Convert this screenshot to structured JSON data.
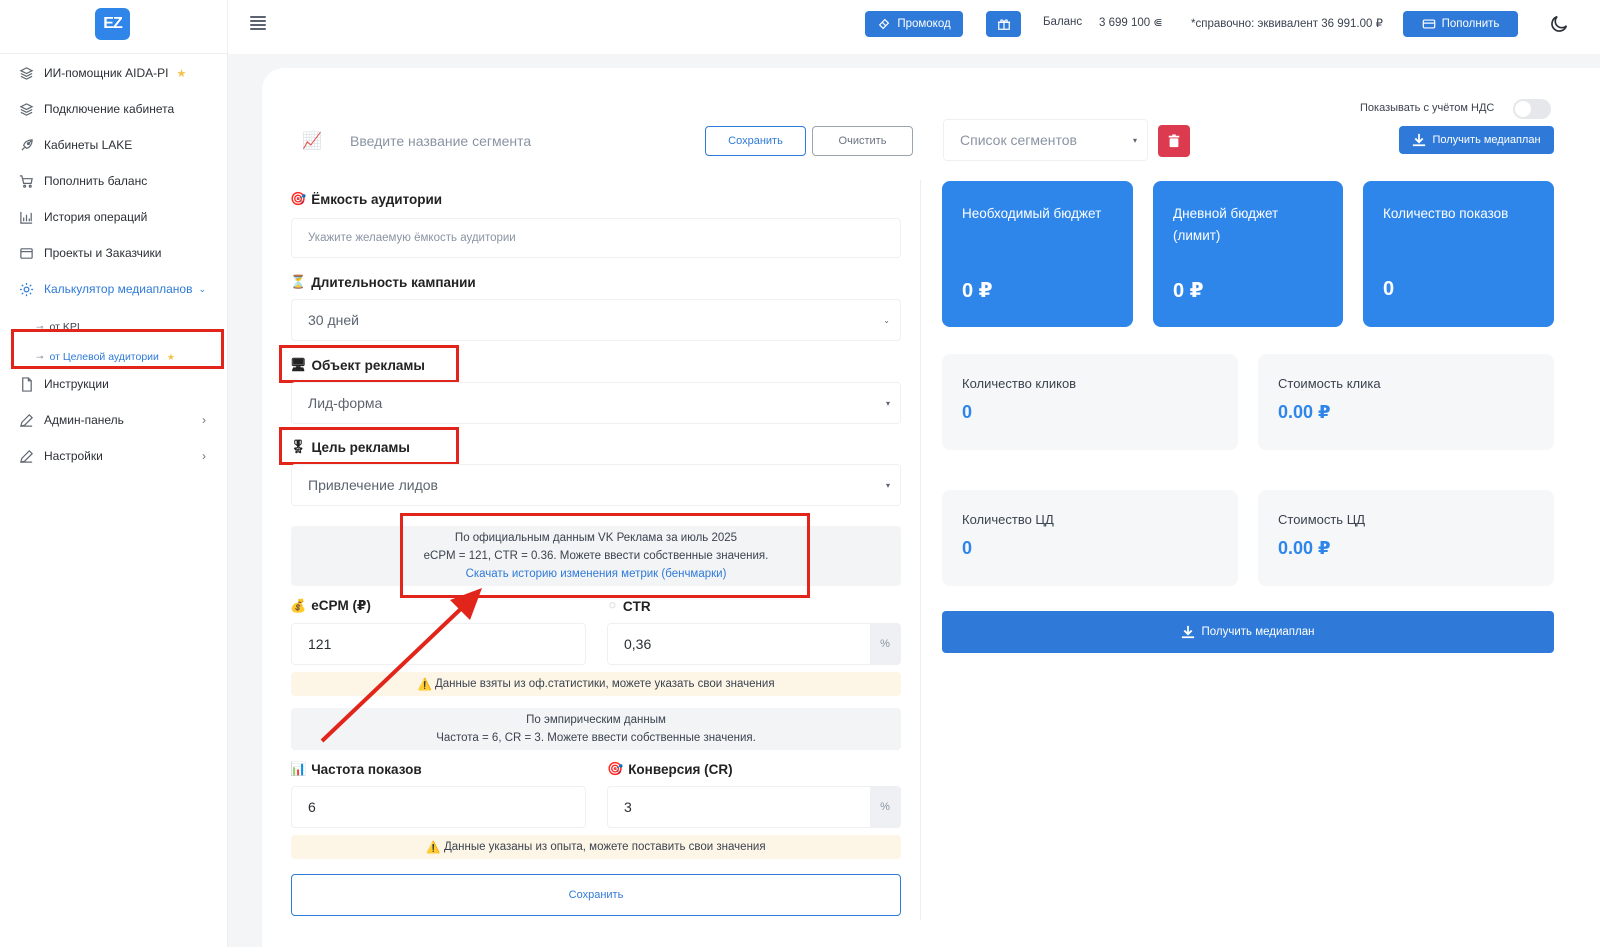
{
  "sidebar": {
    "logo": "EZ",
    "items": [
      {
        "label": "ИИ-помощник AIDA-PI",
        "icon": "layers-icon"
      },
      {
        "label": "Подключение кабинета",
        "icon": "layers-icon"
      },
      {
        "label": "Кабинеты LAKE",
        "icon": "rocket-icon"
      },
      {
        "label": "Пополнить баланс",
        "icon": "cart-icon"
      },
      {
        "label": "История операций",
        "icon": "bar-chart-icon"
      },
      {
        "label": "Проекты и Заказчики",
        "icon": "box-icon"
      },
      {
        "label": "Калькулятор медиапланов",
        "icon": "gear-icon"
      },
      {
        "label": "Инструкции",
        "icon": "file-icon"
      },
      {
        "label": "Админ-панель",
        "icon": "pencil-icon"
      },
      {
        "label": "Настройки",
        "icon": "pencil-icon"
      }
    ],
    "sub_items": [
      {
        "label": "от KPI"
      },
      {
        "label": "от Целевой аудитории"
      }
    ]
  },
  "topbar": {
    "promo_label": "Промокод",
    "balance_label": "Баланс",
    "balance_value": "3 699 100",
    "equivalent": "*справочно: эквивалент 36 991.00 ₽",
    "topup_label": "Пополнить"
  },
  "form": {
    "segment_placeholder": "Введите название сегмента",
    "save_label": "Сохранить",
    "clear_label": "Очистить",
    "audience": {
      "label": "Ёмкость аудитории",
      "placeholder": "Укажите желаемую ёмкость аудитории"
    },
    "duration": {
      "label": "Длительность кампании",
      "value": "30 дней"
    },
    "object": {
      "label": "Объект рекламы",
      "value": "Лид-форма"
    },
    "goal": {
      "label": "Цель рекламы",
      "value": "Привлечение лидов"
    },
    "info": {
      "line1": "По официальным данным VK Реклама за июль 2025",
      "line2": "eCPM = 121, CTR = 0.36. Можете ввести собственные значения.",
      "link": "Скачать историю изменения метрик (бенчмарки)"
    },
    "ecpm": {
      "label": "eCPM (₽)",
      "value": "121"
    },
    "ctr": {
      "label": "CTR",
      "value": "0,36",
      "suffix": "%"
    },
    "warn1": "Данные взяты из оф.статистики, можете указать свои значения",
    "empirical": {
      "line1": "По эмпирическим данным",
      "line2": "Частота = 6, CR = 3. Можете ввести собственные значения."
    },
    "frequency": {
      "label": "Частота показов",
      "value": "6"
    },
    "conversion": {
      "label": "Конверсия (CR)",
      "value": "3",
      "suffix": "%"
    },
    "warn2": "Данные указаны из опыта, можете поставить свои значения",
    "bottom_save": "Сохранить"
  },
  "right": {
    "vat_label": "Показывать с учётом НДС",
    "segments_placeholder": "Список сегментов",
    "get_plan_label": "Получить медиаплан",
    "stats": [
      {
        "title": "Необходимый бюджет",
        "value": "0 ₽"
      },
      {
        "title": "Дневной бюджет (лимит)",
        "value": "0 ₽"
      },
      {
        "title": "Количество показов",
        "value": "0"
      }
    ],
    "mini": [
      {
        "title": "Количество кликов",
        "value": "0"
      },
      {
        "title": "Стоимость клика",
        "value": "0.00 ₽"
      },
      {
        "title": "Количество ЦД",
        "value": "0"
      },
      {
        "title": "Стоимость ЦД",
        "value": "0.00 ₽"
      }
    ],
    "get_plan_big": "Получить медиаплан"
  },
  "colors": {
    "accent": "#2f7ad8",
    "card_blue": "#2f86ea",
    "highlight": "#e1251b",
    "danger": "#dc3a4e"
  }
}
